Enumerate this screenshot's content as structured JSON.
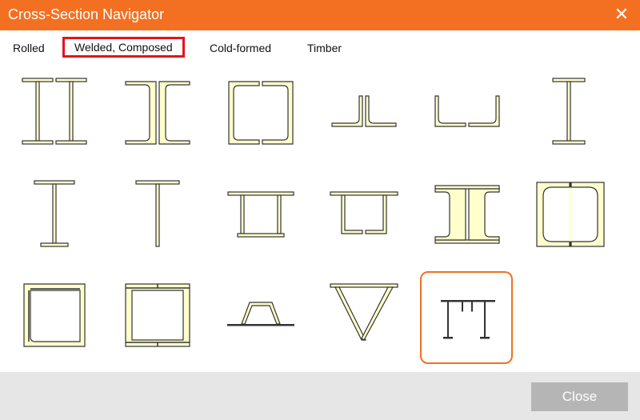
{
  "window": {
    "title": "Cross-Section Navigator",
    "close_glyph": "✕"
  },
  "tabs": [
    {
      "label": "Rolled",
      "selected": false
    },
    {
      "label": "Welded, Composed",
      "selected": true
    },
    {
      "label": "Cold-formed",
      "selected": false
    },
    {
      "label": "Timber",
      "selected": false
    }
  ],
  "sections": [
    {
      "icon": "double-i-section-icon"
    },
    {
      "icon": "double-channel-back-to-back-icon"
    },
    {
      "icon": "double-channel-box-icon"
    },
    {
      "icon": "double-angle-back-to-back-icon"
    },
    {
      "icon": "double-angle-spread-icon"
    },
    {
      "icon": "i-section-icon"
    },
    {
      "icon": "unsymmetric-i-section-icon"
    },
    {
      "icon": "t-section-icon"
    },
    {
      "icon": "box-wide-top-flange-icon"
    },
    {
      "icon": "box-channels-wide-flange-icon"
    },
    {
      "icon": "double-i-plated-icon"
    },
    {
      "icon": "box-plated-channels-icon"
    },
    {
      "icon": "box-plated-welded-icon"
    },
    {
      "icon": "box-two-channels-plated-icon"
    },
    {
      "icon": "trapezoid-hat-section-icon"
    },
    {
      "icon": "triangular-truss-section-icon"
    },
    {
      "icon": "i-section-with-stiffeners-icon"
    }
  ],
  "footer": {
    "close_label": "Close"
  },
  "colors": {
    "accent": "#f37022",
    "selected_tab_border": "#e3141c",
    "section_fill": "#ffffcc"
  }
}
